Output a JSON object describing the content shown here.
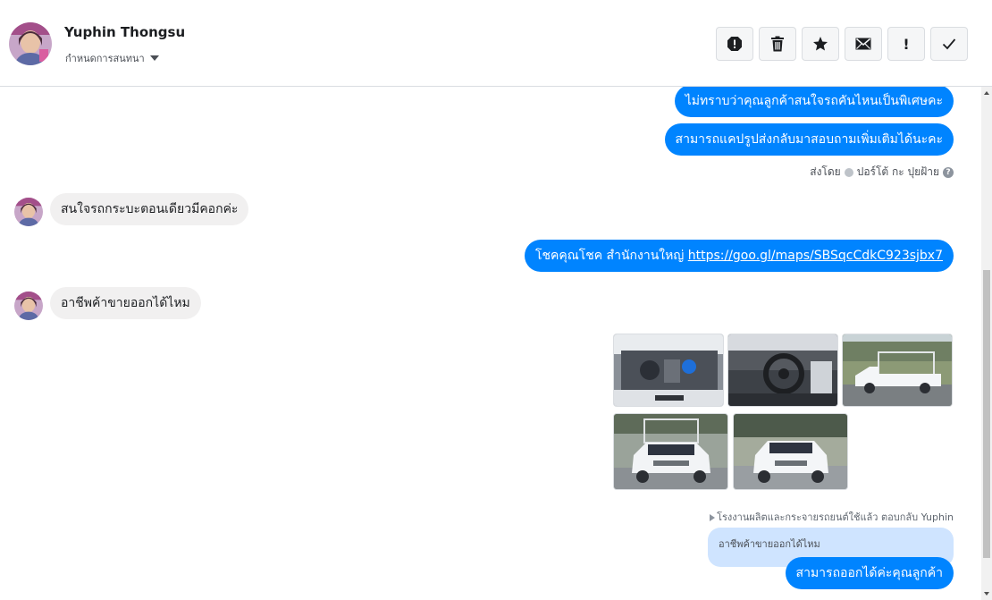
{
  "header": {
    "contact_name": "Yuphin Thongsu",
    "conversation_label": "กำหนดการสนทนา",
    "toolbar": [
      {
        "name": "alert-icon"
      },
      {
        "name": "trash-icon"
      },
      {
        "name": "star-icon"
      },
      {
        "name": "envelope-icon"
      },
      {
        "name": "exclamation-icon",
        "glyph": "!"
      },
      {
        "name": "check-icon"
      }
    ]
  },
  "messages": {
    "out_1": "ไม่ทราบว่าคุณลูกค้าสนใจรถคันไหนเป็นพิเศษคะ",
    "out_2": "สามารถแคปรูปส่งกลับมาสอบถามเพิ่มเติมได้นะคะ",
    "sent_by_prefix": "ส่งโดย",
    "sent_by_name": "ปอร์โต้ กะ ปุยฝ้าย",
    "sent_by_help": "?",
    "in_1": "สนใจรถกระบะตอนเดียวมีคอกค่ะ",
    "out_3_text": "โชคคุณโชค สำนักงานใหญ่ ",
    "out_3_link": "https://goo.gl/maps/SBSqcCdkC923sjbx7",
    "in_2": "อาชีพค้าขายออกได้ไหม",
    "reply_note": "โรงงานผลิตและกระจายรถยนต์ใช้แล้ว ตอบกลับ Yuphin",
    "quoted_text": "อาชีพค้าขายออกได้ไหม",
    "out_4": "สามารถออกได้ค่ะคุณลูกค้า"
  },
  "photos": [
    {
      "name": "photo-engine",
      "subject": "engine bay"
    },
    {
      "name": "photo-interior",
      "subject": "steering wheel interior"
    },
    {
      "name": "photo-side-pickup",
      "subject": "white pickup side view"
    },
    {
      "name": "photo-front-pickup-1",
      "subject": "white pickup with cage front"
    },
    {
      "name": "photo-front-pickup-2",
      "subject": "white pickup front"
    }
  ],
  "colors": {
    "accent": "#0084ff",
    "incoming_bubble": "#f1f0f0",
    "quoted_bubble": "#cfe4ff"
  }
}
